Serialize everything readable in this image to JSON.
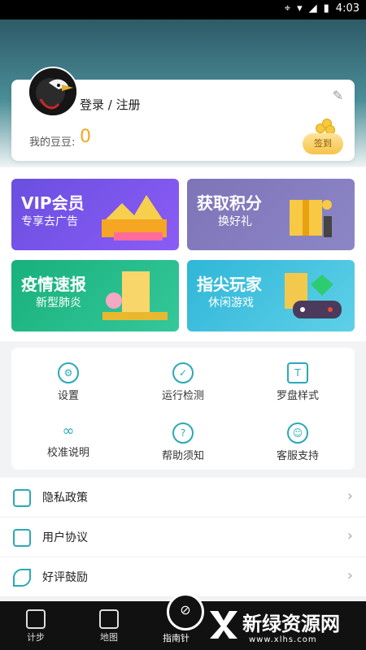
{
  "status_bar": {
    "time": "4:03"
  },
  "profile": {
    "login_text": "登录 / 注册",
    "bean_label": "我的豆豆:",
    "bean_value": "0",
    "signin_label": "签到"
  },
  "banners": [
    {
      "title": "VIP会员",
      "subtitle": "专享去广告"
    },
    {
      "title": "获取积分",
      "subtitle": "换好礼"
    },
    {
      "title": "疫情速报",
      "subtitle": "新型肺炎"
    },
    {
      "title": "指尖玩家",
      "subtitle": "休闲游戏"
    }
  ],
  "grid": [
    {
      "label": "设置",
      "icon": "gear-icon"
    },
    {
      "label": "运行检测",
      "icon": "check-icon"
    },
    {
      "label": "罗盘样式",
      "icon": "shirt-icon"
    },
    {
      "label": "校准说明",
      "icon": "infinity-icon"
    },
    {
      "label": "帮助须知",
      "icon": "question-icon"
    },
    {
      "label": "客服支持",
      "icon": "support-icon"
    }
  ],
  "list": [
    {
      "label": "隐私政策",
      "icon": "document-icon"
    },
    {
      "label": "用户协议",
      "icon": "agreement-icon"
    },
    {
      "label": "好评鼓励",
      "icon": "leaf-icon"
    }
  ],
  "tabs": {
    "step": "计步",
    "map": "地图",
    "compass": "指南针"
  },
  "watermark": {
    "text": "新绿资源网",
    "url": "www.xlhs.com"
  }
}
